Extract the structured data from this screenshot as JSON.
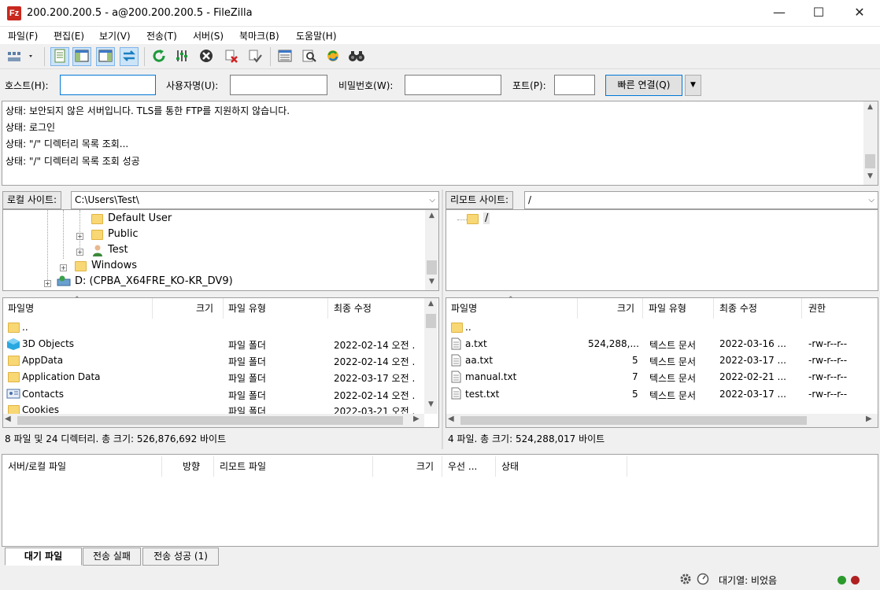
{
  "window": {
    "title": "200.200.200.5 - a@200.200.200.5 - FileZilla",
    "app_icon": "Fz",
    "minimize": "—",
    "maximize": "☐",
    "close": "✕"
  },
  "menu": [
    "파일(F)",
    "편집(E)",
    "보기(V)",
    "전송(T)",
    "서버(S)",
    "북마크(B)",
    "도움말(H)"
  ],
  "quickconnect": {
    "host_label": "호스트(H):",
    "host_value": "",
    "user_label": "사용자명(U):",
    "user_value": "",
    "pass_label": "비밀번호(W):",
    "pass_value": "",
    "port_label": "포트(P):",
    "port_value": "",
    "connect_label": "빠른 연결(Q)",
    "dropdown_icon": "▼"
  },
  "log": [
    "상태:   보안되지 않은 서버입니다. TLS를 통한 FTP를 지원하지 않습니다.",
    "상태:   로그인",
    "상태:   \"/\" 디렉터리 목록 조회...",
    "상태:   \"/\" 디렉터리 목록 조회 성공"
  ],
  "local": {
    "site_label": "로컬 사이트:",
    "path": "C:\\Users\\Test\\",
    "tree": [
      "Default User",
      "Public",
      "Test",
      "Windows",
      "D: (CPBA_X64FRE_KO-KR_DV9)"
    ],
    "columns": [
      "파일명",
      "크기",
      "파일 유형",
      "최종 수정"
    ],
    "files": [
      {
        "name": "..",
        "size": "",
        "type": "",
        "modified": ""
      },
      {
        "name": "3D Objects",
        "size": "",
        "type": "파일 폴더",
        "modified": "2022-02-14 오전 ."
      },
      {
        "name": "AppData",
        "size": "",
        "type": "파일 폴더",
        "modified": "2022-02-14 오전 ."
      },
      {
        "name": "Application Data",
        "size": "",
        "type": "파일 폴더",
        "modified": "2022-03-17 오전 ."
      },
      {
        "name": "Contacts",
        "size": "",
        "type": "파일 폴더",
        "modified": "2022-02-14 오전 ."
      },
      {
        "name": "Cookies",
        "size": "",
        "type": "파일 폴더",
        "modified": "2022-03-21 오전 ."
      }
    ],
    "status": "8 파일 및 24 디렉터리. 총 크기: 526,876,692 바이트"
  },
  "remote": {
    "site_label": "리모트 사이트:",
    "path": "/",
    "tree": [
      "/"
    ],
    "columns": [
      "파일명",
      "크기",
      "파일 유형",
      "최종 수정",
      "권한"
    ],
    "files": [
      {
        "name": "..",
        "size": "",
        "type": "",
        "modified": "",
        "perm": ""
      },
      {
        "name": "a.txt",
        "size": "524,288,...",
        "type": "텍스트 문서",
        "modified": "2022-03-16 ...",
        "perm": "-rw-r--r--"
      },
      {
        "name": "aa.txt",
        "size": "5",
        "type": "텍스트 문서",
        "modified": "2022-03-17 ...",
        "perm": "-rw-r--r--"
      },
      {
        "name": "manual.txt",
        "size": "7",
        "type": "텍스트 문서",
        "modified": "2022-02-21 ...",
        "perm": "-rw-r--r--"
      },
      {
        "name": "test.txt",
        "size": "5",
        "type": "텍스트 문서",
        "modified": "2022-03-17 ...",
        "perm": "-rw-r--r--"
      }
    ],
    "status": "4 파일. 총 크기: 524,288,017 바이트"
  },
  "queue": {
    "columns": [
      "서버/로컬 파일",
      "방향",
      "리모트 파일",
      "크기",
      "우선 ...",
      "상태"
    ],
    "tabs": [
      "대기 파일",
      "전송 실패",
      "전송 성공 (1)"
    ],
    "status": "대기열: 비었음"
  }
}
